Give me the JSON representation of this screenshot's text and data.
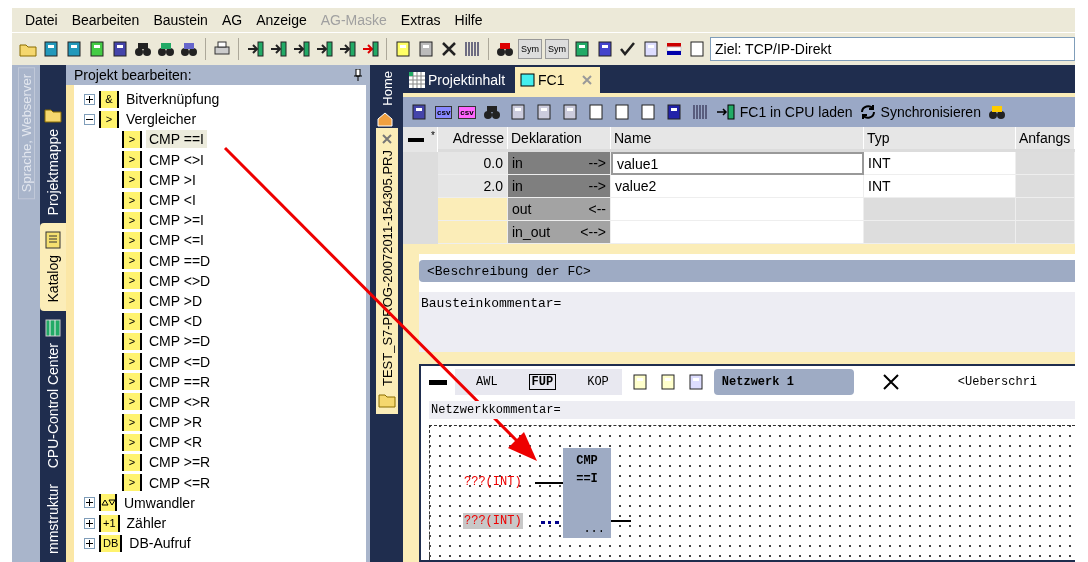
{
  "menu": [
    {
      "label": "Datei",
      "disabled": false
    },
    {
      "label": "Bearbeiten",
      "disabled": false
    },
    {
      "label": "Baustein",
      "disabled": false
    },
    {
      "label": "AG",
      "disabled": false
    },
    {
      "label": "Anzeige",
      "disabled": false
    },
    {
      "label": "AG-Maske",
      "disabled": true
    },
    {
      "label": "Extras",
      "disabled": false
    },
    {
      "label": "Hilfe",
      "disabled": false
    }
  ],
  "toolbar": {
    "sym_buttons": [
      "Sym",
      "Sym"
    ],
    "target": "Ziel: TCP/IP-Direkt"
  },
  "side_tabs": [
    {
      "label": "Sprache, Webserver",
      "disabled": true
    }
  ],
  "panel_tabs": [
    {
      "label": "Projektmappe",
      "selected": false,
      "kind": "folder"
    },
    {
      "label": "Katalog",
      "selected": true,
      "kind": "catalog"
    },
    {
      "label": "CPU-Control Center",
      "selected": false,
      "kind": "cpu"
    },
    {
      "label": "mmstruktur",
      "selected": false,
      "kind": "none"
    }
  ],
  "catalog": {
    "title": "Projekt bearbeiten:",
    "tree": [
      {
        "label": "Bitverknüpfung",
        "kind": "text",
        "badge": "&",
        "expanded": false
      },
      {
        "label": "Vergleicher",
        "kind": "text",
        "badge": ">",
        "expanded": true,
        "children": [
          {
            "label": "CMP ==I",
            "badge": ">",
            "selected": true
          },
          {
            "label": "CMP <>I",
            "badge": ">",
            "selected": false
          },
          {
            "label": "CMP >I",
            "badge": ">",
            "selected": false
          },
          {
            "label": "CMP <I",
            "badge": ">",
            "selected": false
          },
          {
            "label": "CMP >=I",
            "badge": ">",
            "selected": false
          },
          {
            "label": "CMP <=I",
            "badge": ">",
            "selected": false
          },
          {
            "label": "CMP ==D",
            "badge": ">",
            "selected": false
          },
          {
            "label": "CMP <>D",
            "badge": ">",
            "selected": false
          },
          {
            "label": "CMP >D",
            "badge": ">",
            "selected": false
          },
          {
            "label": "CMP <D",
            "badge": ">",
            "selected": false
          },
          {
            "label": "CMP >=D",
            "badge": ">",
            "selected": false
          },
          {
            "label": "CMP <=D",
            "badge": ">",
            "selected": false
          },
          {
            "label": "CMP ==R",
            "badge": ">",
            "selected": false
          },
          {
            "label": "CMP <>R",
            "badge": ">",
            "selected": false
          },
          {
            "label": "CMP >R",
            "badge": ">",
            "selected": false
          },
          {
            "label": "CMP <R",
            "badge": ">",
            "selected": false
          },
          {
            "label": "CMP >=R",
            "badge": ">",
            "selected": false
          },
          {
            "label": "CMP <=R",
            "badge": ">",
            "selected": false
          }
        ]
      },
      {
        "label": "Umwandler",
        "kind": "convert",
        "expanded": false
      },
      {
        "label": "Zähler",
        "kind": "text",
        "badge": "+1",
        "expanded": false
      },
      {
        "label": "DB-Aufruf",
        "kind": "text",
        "badge": "DB",
        "expanded": false
      }
    ]
  },
  "editor": {
    "home_tab": "Home",
    "project_tab": "TEST_S7-PROG-20072011-154305.PRJ",
    "tabs": [
      {
        "label": "Projektinhalt",
        "selected": false,
        "kind": "grid"
      },
      {
        "label": "FC1",
        "selected": true,
        "kind": "block"
      }
    ],
    "toolbar": {
      "csv_buttons": [
        "csv",
        "csv"
      ],
      "buttons": [
        {
          "label": "FC1 in CPU laden",
          "kind": "load"
        },
        {
          "label": "Synchronisieren",
          "kind": "sync"
        }
      ]
    },
    "declarations": {
      "marker": "*",
      "columns": [
        "Adresse",
        "Deklaration",
        "Name",
        "Typ",
        "Anfangs"
      ],
      "rows": [
        {
          "address": "0.0",
          "declaration": "in",
          "arrow": "-->",
          "name": "value1",
          "type": "INT",
          "editing": true
        },
        {
          "address": "2.0",
          "declaration": "in",
          "arrow": "-->",
          "name": "value2",
          "type": "INT",
          "editing": false
        },
        {
          "declaration": "out",
          "arrow": "<--",
          "editing": false
        },
        {
          "declaration": "in_out",
          "arrow": "<-->",
          "editing": false
        }
      ]
    },
    "description": {
      "header": "<Beschreibung der FC>",
      "comment": "Bausteinkommentar="
    },
    "network": {
      "modes": [
        {
          "label": "AWL",
          "selected": false
        },
        {
          "label": "FUP",
          "selected": true
        },
        {
          "label": "KOP",
          "selected": false
        }
      ],
      "title": "Netzwerk 1",
      "heading": "<Ueberschri",
      "comment": "Netzwerkkommentar=",
      "block": {
        "name": "CMP",
        "op": "==I",
        "more": "..."
      },
      "inputs": [
        {
          "label": "???(INT)",
          "highlighted": false
        },
        {
          "label": "???(INT)",
          "highlighted": true
        }
      ]
    }
  }
}
